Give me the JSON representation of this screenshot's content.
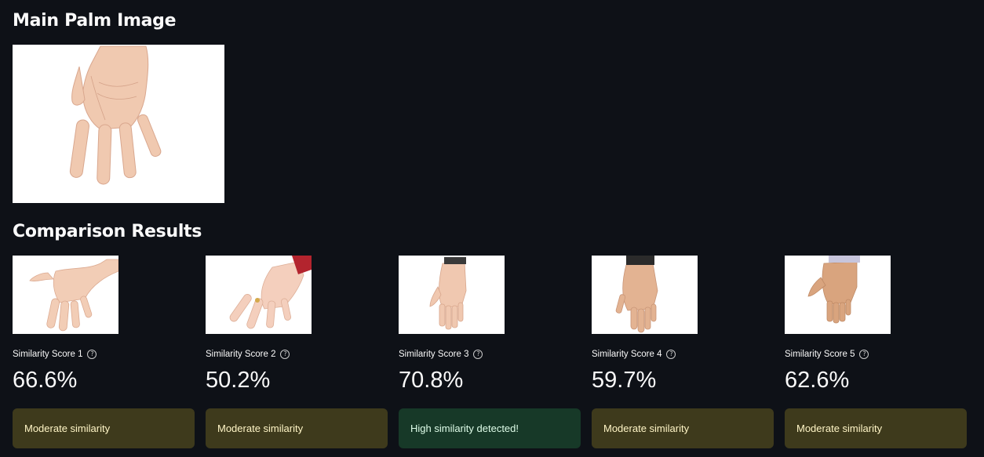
{
  "main": {
    "title": "Main Palm Image"
  },
  "results": {
    "title": "Comparison Results",
    "cards": [
      {
        "label": "Similarity Score 1",
        "value": "66.6%",
        "status": "Moderate similarity",
        "status_type": "warning"
      },
      {
        "label": "Similarity Score 2",
        "value": "50.2%",
        "status": "Moderate similarity",
        "status_type": "warning"
      },
      {
        "label": "Similarity Score 3",
        "value": "70.8%",
        "status": "High similarity detected!",
        "status_type": "success"
      },
      {
        "label": "Similarity Score 4",
        "value": "59.7%",
        "status": "Moderate similarity",
        "status_type": "warning"
      },
      {
        "label": "Similarity Score 5",
        "value": "62.6%",
        "status": "Moderate similarity",
        "status_type": "warning"
      }
    ]
  },
  "icons": {
    "help": "help-circle-icon"
  },
  "colors": {
    "background": "#0e1117",
    "warning_bg": "#3e3a1c",
    "success_bg": "#173928"
  }
}
